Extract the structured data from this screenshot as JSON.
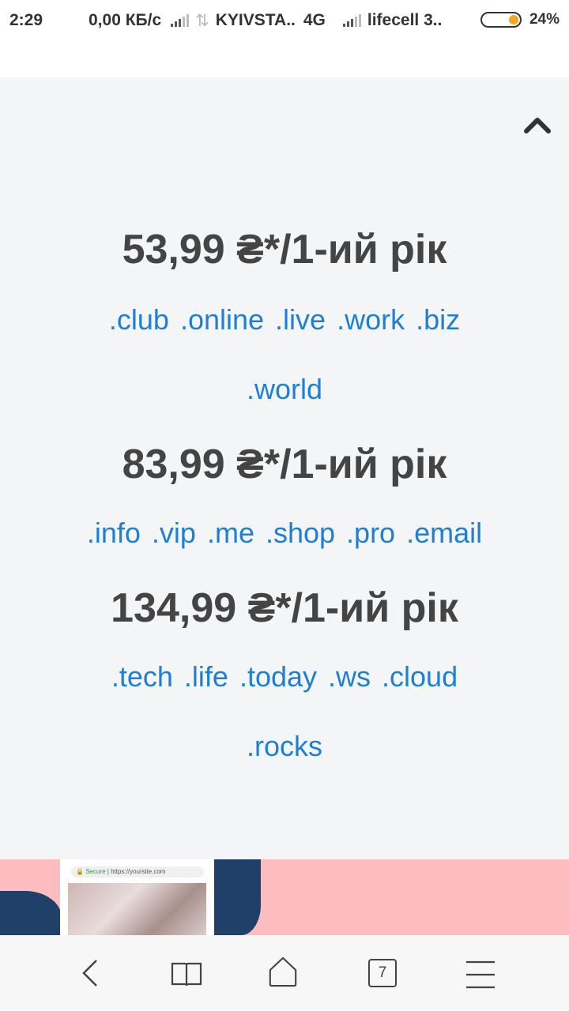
{
  "status_bar": {
    "time": "2:29",
    "speed": "0,00 КБ/с",
    "carrier1": "KYIVSTA..",
    "network": "4G",
    "carrier2": "lifecell 3..",
    "battery": "24%",
    "battery_color": "#f5a623"
  },
  "page": {
    "collapse_icon": "chevron-up-icon",
    "groups": [
      {
        "price": "53,99 ₴*/1-ий рік",
        "zones_line1": [
          ".club",
          ".online",
          ".live",
          ".work",
          ".biz"
        ],
        "zones_line2": [
          ".world"
        ]
      },
      {
        "price": "83,99 ₴*/1-ий рік",
        "zones_line1": [
          ".info",
          ".vip",
          ".me",
          ".shop",
          ".pro",
          ".email"
        ]
      },
      {
        "price": "134,99 ₴*/1-ий рік",
        "zones_line1": [
          ".tech",
          ".life",
          ".today",
          ".ws",
          ".cloud"
        ],
        "zones_line2": [
          ".rocks"
        ]
      }
    ],
    "accent_color": "#1f7fd6",
    "banner": {
      "secure": "Secure",
      "url": "https://yoursite.com"
    }
  },
  "browser_nav": {
    "back_icon": "back-icon",
    "bookmarks_icon": "book-icon",
    "home_icon": "home-icon",
    "tabs_count": "7",
    "menu_icon": "menu-icon"
  }
}
